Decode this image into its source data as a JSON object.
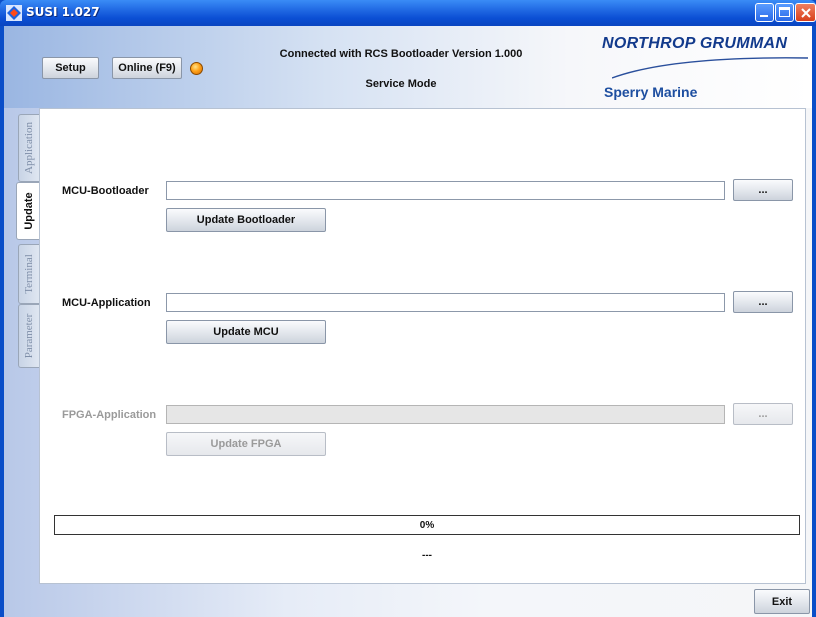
{
  "window": {
    "title": "SUSI 1.027"
  },
  "header": {
    "setup_label": "Setup",
    "online_label": "Online (F9)",
    "connection_text": "Connected with RCS Bootloader Version 1.000",
    "mode_text": "Service Mode",
    "logo_company": "NORTHROP GRUMMAN",
    "logo_division": "Sperry Marine"
  },
  "tabs": [
    {
      "label": "Application",
      "active": false
    },
    {
      "label": "Update",
      "active": true
    },
    {
      "label": "Terminal",
      "active": false
    },
    {
      "label": "Parameter",
      "active": false
    }
  ],
  "update": {
    "bootloader": {
      "label": "MCU-Bootloader",
      "path": "",
      "browse_label": "...",
      "action_label": "Update Bootloader",
      "enabled": true
    },
    "application": {
      "label": "MCU-Application",
      "path": "",
      "browse_label": "...",
      "action_label": "Update MCU",
      "enabled": true
    },
    "fpga": {
      "label": "FPGA-Application",
      "path": "",
      "browse_label": "...",
      "action_label": "Update FPGA",
      "enabled": false
    }
  },
  "progress": {
    "percent_text": "0%",
    "value": 0
  },
  "status_text": "---",
  "footer": {
    "exit_label": "Exit"
  },
  "colors": {
    "titlebar": "#0b4fd4",
    "accent_led": "#ffa21a",
    "logo": "#123a8c"
  }
}
